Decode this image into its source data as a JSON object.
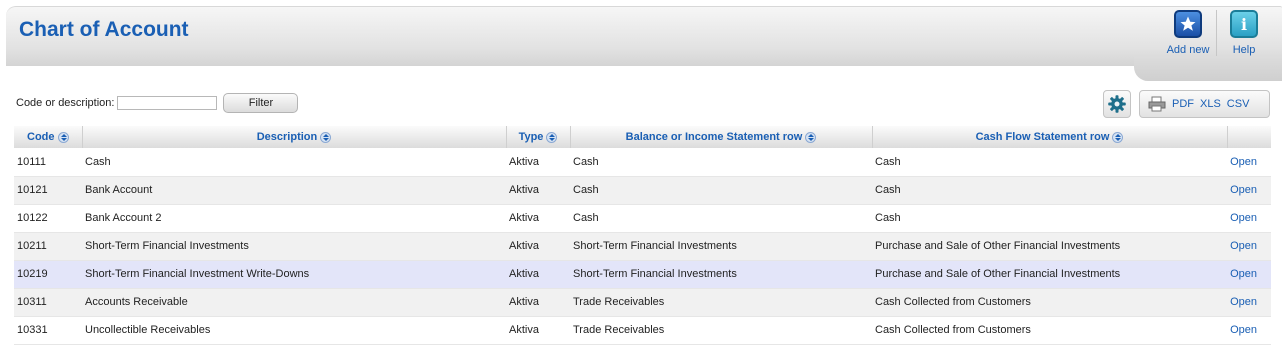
{
  "header": {
    "title": "Chart of Account",
    "add_new_label": "Add new",
    "help_label": "Help",
    "add_new_icon": "star-icon",
    "help_icon": "info-icon"
  },
  "filter": {
    "label": "Code or description:",
    "value": "",
    "placeholder": "",
    "button_label": "Filter"
  },
  "toolbar": {
    "settings_icon": "gear-icon",
    "export_icon": "print-icon",
    "pdf_label": "PDF",
    "xls_label": "XLS",
    "csv_label": "CSV"
  },
  "table": {
    "columns": [
      "Code",
      "Description",
      "Type",
      "Balance or Income Statement row",
      "Cash Flow Statement row"
    ],
    "rows": [
      {
        "code": "10111",
        "description": "Cash",
        "type": "Aktiva",
        "balance_row": "Cash",
        "cashflow_row": "Cash",
        "action": "Open",
        "highlighted": false
      },
      {
        "code": "10121",
        "description": "Bank Account",
        "type": "Aktiva",
        "balance_row": "Cash",
        "cashflow_row": "Cash",
        "action": "Open",
        "highlighted": false
      },
      {
        "code": "10122",
        "description": "Bank Account 2",
        "type": "Aktiva",
        "balance_row": "Cash",
        "cashflow_row": "Cash",
        "action": "Open",
        "highlighted": false
      },
      {
        "code": "10211",
        "description": "Short-Term Financial Investments",
        "type": "Aktiva",
        "balance_row": "Short-Term Financial Investments",
        "cashflow_row": "Purchase and Sale of Other Financial Investments",
        "action": "Open",
        "highlighted": false
      },
      {
        "code": "10219",
        "description": "Short-Term Financial Investment Write-Downs",
        "type": "Aktiva",
        "balance_row": "Short-Term Financial Investments",
        "cashflow_row": "Purchase and Sale of Other Financial Investments",
        "action": "Open",
        "highlighted": true
      },
      {
        "code": "10311",
        "description": "Accounts Receivable",
        "type": "Aktiva",
        "balance_row": "Trade Receivables",
        "cashflow_row": "Cash Collected from Customers",
        "action": "Open",
        "highlighted": false
      },
      {
        "code": "10331",
        "description": "Uncollectible Receivables",
        "type": "Aktiva",
        "balance_row": "Trade Receivables",
        "cashflow_row": "Cash Collected from Customers",
        "action": "Open",
        "highlighted": false
      }
    ]
  },
  "colors": {
    "accent": "#1a5fb4",
    "row_highlight": "#e3e5f9",
    "row_alt": "#f1f1f1"
  }
}
